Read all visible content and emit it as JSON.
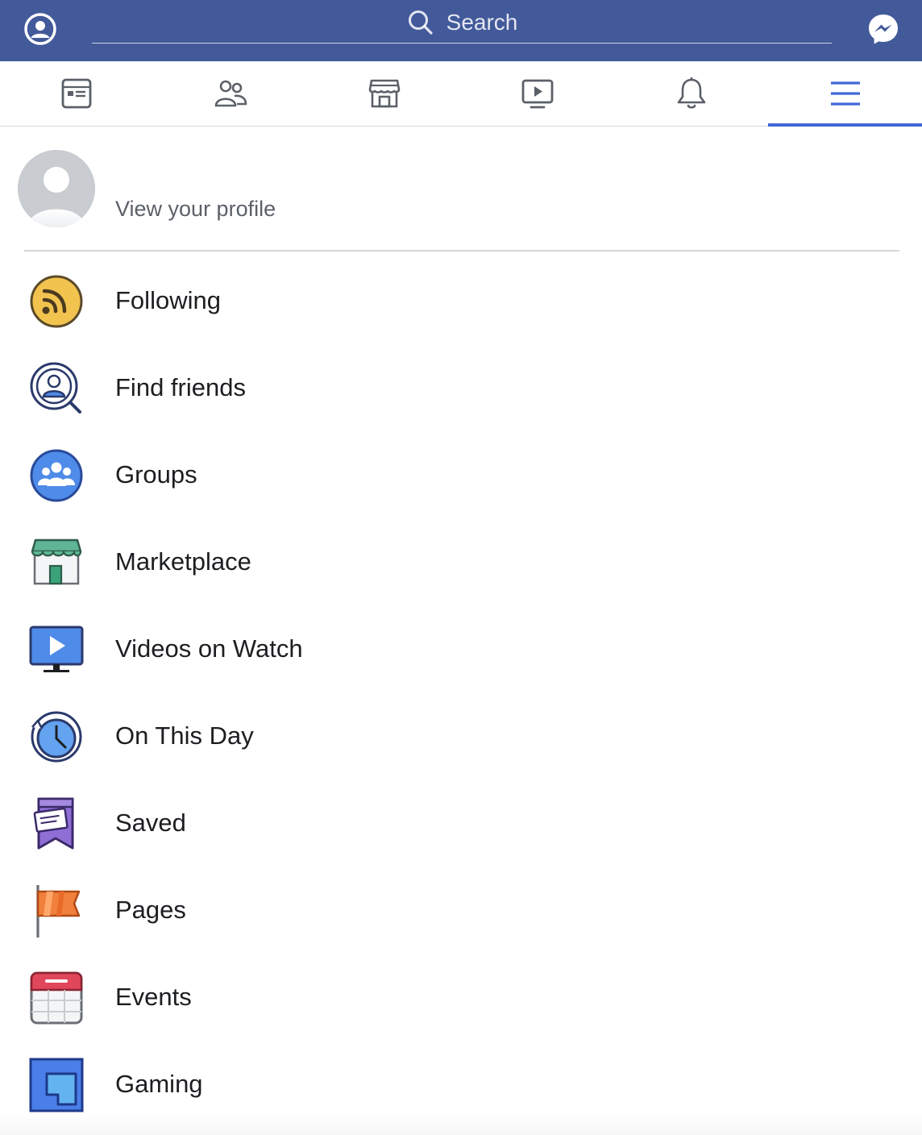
{
  "colors": {
    "brand_blue": "#42599a",
    "tab_active": "#4267d6",
    "text_primary": "#1c1e21",
    "text_secondary": "#5b6068"
  },
  "header": {
    "profile_icon": "user-circle-icon",
    "search_icon": "search-icon",
    "search_placeholder": "Search",
    "messenger_icon": "messenger-icon"
  },
  "tabs": [
    {
      "name": "news-feed",
      "icon": "news-feed-icon",
      "active": false
    },
    {
      "name": "friends",
      "icon": "friends-icon",
      "active": false
    },
    {
      "name": "marketplace",
      "icon": "store-icon",
      "active": false
    },
    {
      "name": "watch",
      "icon": "video-icon",
      "active": false
    },
    {
      "name": "notifications",
      "icon": "bell-icon",
      "active": false
    },
    {
      "name": "menu",
      "icon": "hamburger-icon",
      "active": true
    }
  ],
  "profile": {
    "label": "View your profile",
    "avatar_icon": "default-avatar-icon"
  },
  "menu": {
    "items": [
      {
        "label": "Following",
        "icon": "rss-icon"
      },
      {
        "label": "Find friends",
        "icon": "find-friends-icon"
      },
      {
        "label": "Groups",
        "icon": "groups-icon"
      },
      {
        "label": "Marketplace",
        "icon": "marketplace-icon"
      },
      {
        "label": "Videos on Watch",
        "icon": "watch-video-icon"
      },
      {
        "label": "On This Day",
        "icon": "memories-clock-icon"
      },
      {
        "label": "Saved",
        "icon": "saved-bookmark-icon"
      },
      {
        "label": "Pages",
        "icon": "flag-icon"
      },
      {
        "label": "Events",
        "icon": "calendar-icon"
      },
      {
        "label": "Gaming",
        "icon": "gaming-icon"
      }
    ]
  }
}
